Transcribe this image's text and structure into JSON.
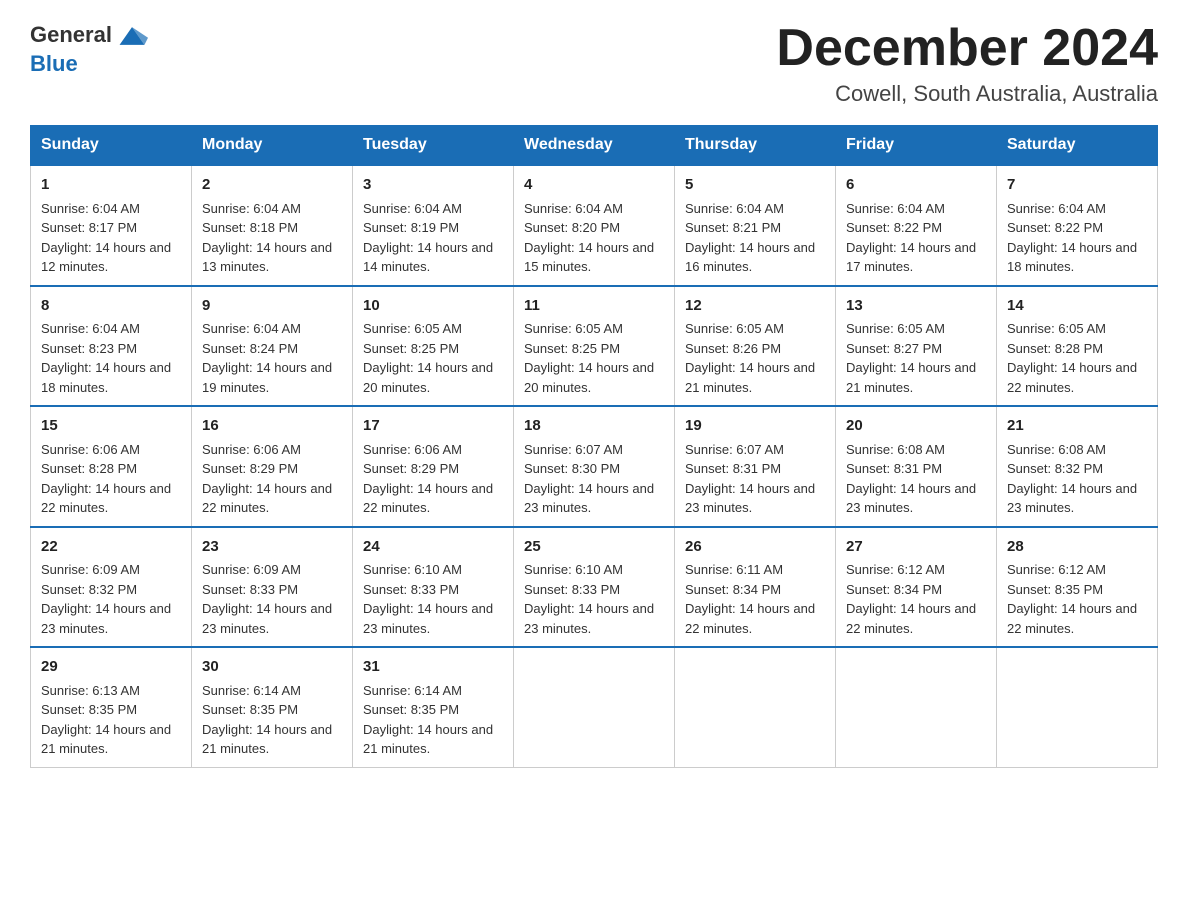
{
  "header": {
    "logo_line1": "General",
    "logo_line2": "Blue",
    "month": "December 2024",
    "location": "Cowell, South Australia, Australia"
  },
  "days_of_week": [
    "Sunday",
    "Monday",
    "Tuesday",
    "Wednesday",
    "Thursday",
    "Friday",
    "Saturday"
  ],
  "weeks": [
    [
      {
        "day": 1,
        "sunrise": "6:04 AM",
        "sunset": "8:17 PM",
        "daylight": "14 hours and 12 minutes."
      },
      {
        "day": 2,
        "sunrise": "6:04 AM",
        "sunset": "8:18 PM",
        "daylight": "14 hours and 13 minutes."
      },
      {
        "day": 3,
        "sunrise": "6:04 AM",
        "sunset": "8:19 PM",
        "daylight": "14 hours and 14 minutes."
      },
      {
        "day": 4,
        "sunrise": "6:04 AM",
        "sunset": "8:20 PM",
        "daylight": "14 hours and 15 minutes."
      },
      {
        "day": 5,
        "sunrise": "6:04 AM",
        "sunset": "8:21 PM",
        "daylight": "14 hours and 16 minutes."
      },
      {
        "day": 6,
        "sunrise": "6:04 AM",
        "sunset": "8:22 PM",
        "daylight": "14 hours and 17 minutes."
      },
      {
        "day": 7,
        "sunrise": "6:04 AM",
        "sunset": "8:22 PM",
        "daylight": "14 hours and 18 minutes."
      }
    ],
    [
      {
        "day": 8,
        "sunrise": "6:04 AM",
        "sunset": "8:23 PM",
        "daylight": "14 hours and 18 minutes."
      },
      {
        "day": 9,
        "sunrise": "6:04 AM",
        "sunset": "8:24 PM",
        "daylight": "14 hours and 19 minutes."
      },
      {
        "day": 10,
        "sunrise": "6:05 AM",
        "sunset": "8:25 PM",
        "daylight": "14 hours and 20 minutes."
      },
      {
        "day": 11,
        "sunrise": "6:05 AM",
        "sunset": "8:25 PM",
        "daylight": "14 hours and 20 minutes."
      },
      {
        "day": 12,
        "sunrise": "6:05 AM",
        "sunset": "8:26 PM",
        "daylight": "14 hours and 21 minutes."
      },
      {
        "day": 13,
        "sunrise": "6:05 AM",
        "sunset": "8:27 PM",
        "daylight": "14 hours and 21 minutes."
      },
      {
        "day": 14,
        "sunrise": "6:05 AM",
        "sunset": "8:28 PM",
        "daylight": "14 hours and 22 minutes."
      }
    ],
    [
      {
        "day": 15,
        "sunrise": "6:06 AM",
        "sunset": "8:28 PM",
        "daylight": "14 hours and 22 minutes."
      },
      {
        "day": 16,
        "sunrise": "6:06 AM",
        "sunset": "8:29 PM",
        "daylight": "14 hours and 22 minutes."
      },
      {
        "day": 17,
        "sunrise": "6:06 AM",
        "sunset": "8:29 PM",
        "daylight": "14 hours and 22 minutes."
      },
      {
        "day": 18,
        "sunrise": "6:07 AM",
        "sunset": "8:30 PM",
        "daylight": "14 hours and 23 minutes."
      },
      {
        "day": 19,
        "sunrise": "6:07 AM",
        "sunset": "8:31 PM",
        "daylight": "14 hours and 23 minutes."
      },
      {
        "day": 20,
        "sunrise": "6:08 AM",
        "sunset": "8:31 PM",
        "daylight": "14 hours and 23 minutes."
      },
      {
        "day": 21,
        "sunrise": "6:08 AM",
        "sunset": "8:32 PM",
        "daylight": "14 hours and 23 minutes."
      }
    ],
    [
      {
        "day": 22,
        "sunrise": "6:09 AM",
        "sunset": "8:32 PM",
        "daylight": "14 hours and 23 minutes."
      },
      {
        "day": 23,
        "sunrise": "6:09 AM",
        "sunset": "8:33 PM",
        "daylight": "14 hours and 23 minutes."
      },
      {
        "day": 24,
        "sunrise": "6:10 AM",
        "sunset": "8:33 PM",
        "daylight": "14 hours and 23 minutes."
      },
      {
        "day": 25,
        "sunrise": "6:10 AM",
        "sunset": "8:33 PM",
        "daylight": "14 hours and 23 minutes."
      },
      {
        "day": 26,
        "sunrise": "6:11 AM",
        "sunset": "8:34 PM",
        "daylight": "14 hours and 22 minutes."
      },
      {
        "day": 27,
        "sunrise": "6:12 AM",
        "sunset": "8:34 PM",
        "daylight": "14 hours and 22 minutes."
      },
      {
        "day": 28,
        "sunrise": "6:12 AM",
        "sunset": "8:35 PM",
        "daylight": "14 hours and 22 minutes."
      }
    ],
    [
      {
        "day": 29,
        "sunrise": "6:13 AM",
        "sunset": "8:35 PM",
        "daylight": "14 hours and 21 minutes."
      },
      {
        "day": 30,
        "sunrise": "6:14 AM",
        "sunset": "8:35 PM",
        "daylight": "14 hours and 21 minutes."
      },
      {
        "day": 31,
        "sunrise": "6:14 AM",
        "sunset": "8:35 PM",
        "daylight": "14 hours and 21 minutes."
      },
      null,
      null,
      null,
      null
    ]
  ]
}
